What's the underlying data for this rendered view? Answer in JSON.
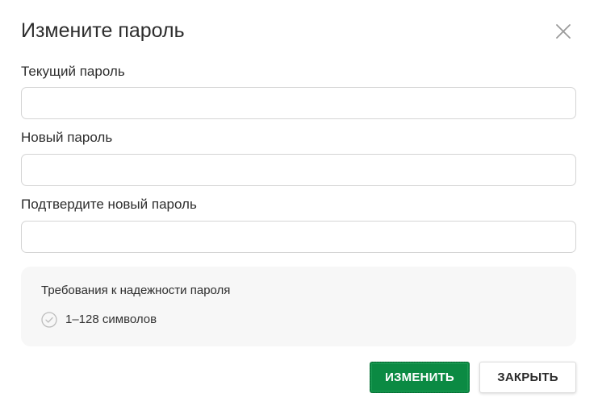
{
  "dialog": {
    "title": "Измените пароль"
  },
  "fields": {
    "current": {
      "label": "Текущий пароль",
      "value": ""
    },
    "new": {
      "label": "Новый пароль",
      "value": ""
    },
    "confirm": {
      "label": "Подтвердите новый пароль",
      "value": ""
    }
  },
  "requirements": {
    "title": "Требования к надежности пароля",
    "items": [
      {
        "text": "1–128 символов"
      }
    ]
  },
  "buttons": {
    "submit_label": "ИЗМЕНИТЬ",
    "close_label": "ЗАКРЫТЬ"
  },
  "colors": {
    "primary": "#0b8a43",
    "check": "#bdbdbd",
    "req_bg": "#f7f7f7"
  },
  "icons": {
    "close": "close-icon",
    "check": "check-circle-icon"
  }
}
